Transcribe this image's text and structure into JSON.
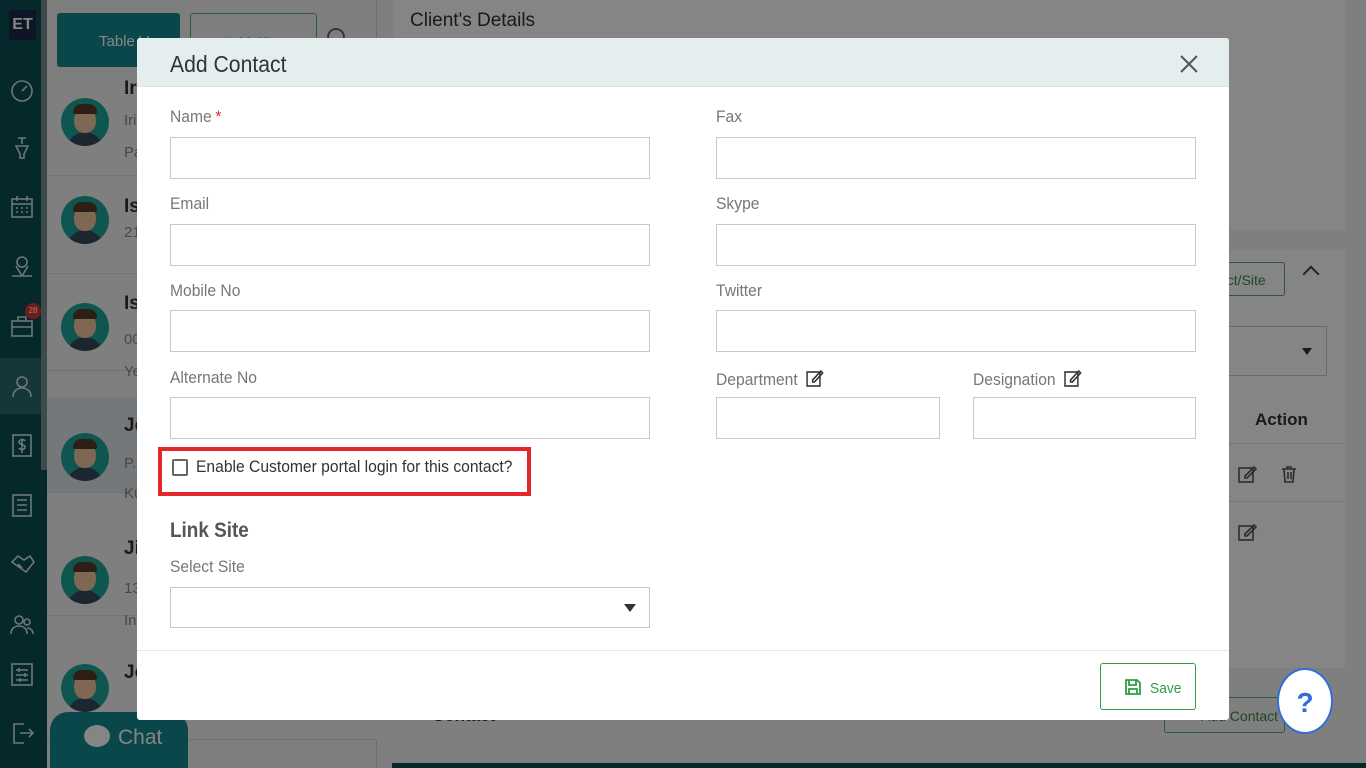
{
  "app": {
    "logo": "ET",
    "briefcase_badge": "28"
  },
  "client_list": {
    "table_view_label": "Table V",
    "add_client_label": "Add Client",
    "rows": [
      {
        "name": "Ir",
        "line2": "Iri",
        "line3": "Pa"
      },
      {
        "name": "Is",
        "line2": "21",
        "line3": ""
      },
      {
        "name": "Is",
        "line2": "00",
        "line3": "Ye"
      },
      {
        "name": "Je",
        "line2": "P.",
        "line3": "Ku"
      },
      {
        "name": "Ji",
        "line2": "13",
        "line3": "In"
      },
      {
        "name": "Jo",
        "line2": "",
        "line3": ""
      }
    ]
  },
  "details": {
    "title": "Client's Details",
    "project_site_label": "ect/Site",
    "action_header": "Action",
    "contact_header": "Contact",
    "add_contact_label": "Add Contact"
  },
  "chat_label": "Chat",
  "help_label": "?",
  "modal": {
    "title": "Add Contact",
    "close_label": "×",
    "fields": {
      "name": {
        "label": "Name",
        "required": "*",
        "value": ""
      },
      "email": {
        "label": "Email",
        "value": ""
      },
      "mobile": {
        "label": "Mobile No",
        "value": ""
      },
      "alternate": {
        "label": "Alternate No",
        "value": ""
      },
      "fax": {
        "label": "Fax",
        "value": ""
      },
      "skype": {
        "label": "Skype",
        "value": ""
      },
      "twitter": {
        "label": "Twitter",
        "value": ""
      },
      "department": {
        "label": "Department",
        "value": ""
      },
      "designation": {
        "label": "Designation",
        "value": ""
      }
    },
    "portal_checkbox_label": "Enable Customer portal login for this contact?",
    "portal_checked": false,
    "link_site_heading": "Link Site",
    "select_site_label": "Select Site",
    "select_site_value": "",
    "save_label": "Save"
  },
  "colors": {
    "teal": "#12898f",
    "rail": "#0b4d52",
    "green": "#2e9e46",
    "highlight_red": "#e3262b",
    "required_red": "#d9342b"
  }
}
